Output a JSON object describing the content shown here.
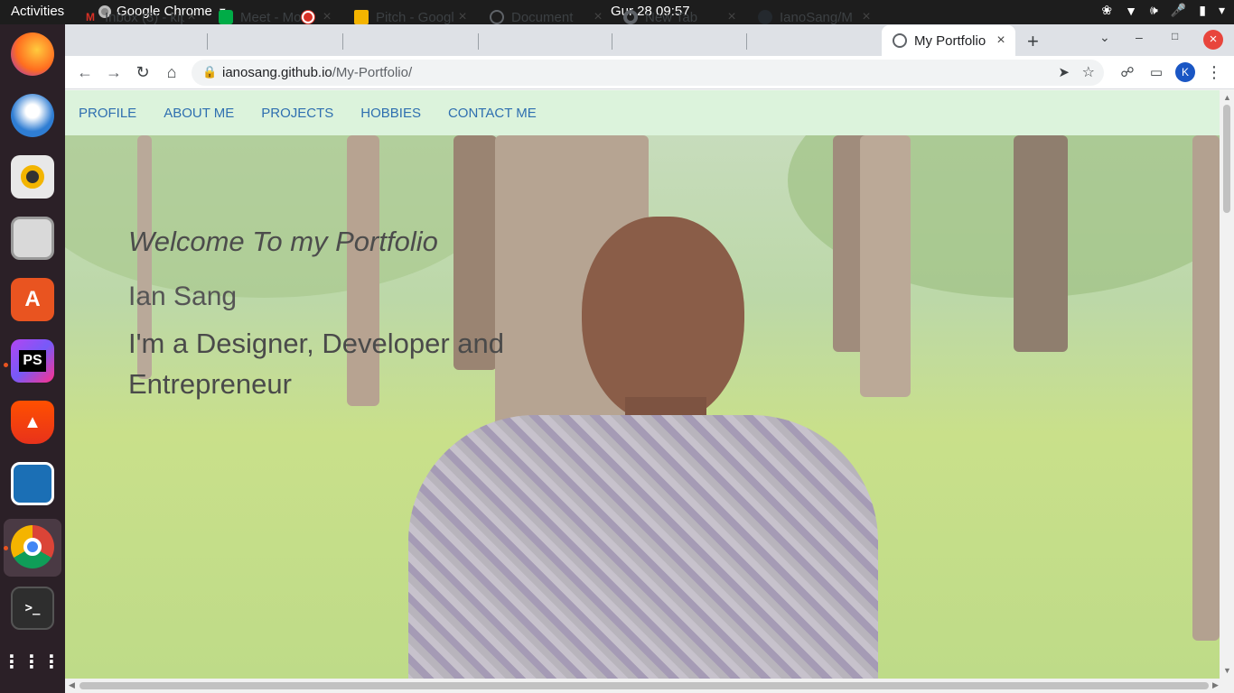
{
  "topbar": {
    "activities": "Activities",
    "app_name": "Google Chrome",
    "clock": "Gur 28  09:57"
  },
  "dock": {
    "items": [
      "firefox",
      "thunderbird",
      "rhythmbox",
      "files",
      "software",
      "phpstorm",
      "brave",
      "writer",
      "chrome",
      "terminal",
      "show-apps"
    ]
  },
  "browser": {
    "tabs": [
      {
        "label": "Inbox (3) - kip",
        "icon": "gmail-icon"
      },
      {
        "label": "Meet - Mo",
        "icon": "meet-icon"
      },
      {
        "label": "Pitch - Googl",
        "icon": "slides-icon"
      },
      {
        "label": "Document",
        "icon": "globe-icon"
      },
      {
        "label": "New Tab",
        "icon": "chrome-icon"
      },
      {
        "label": "IanoSang/M",
        "icon": "github-icon"
      },
      {
        "label": "My Portfolio",
        "icon": "globe-icon"
      }
    ],
    "url_host": "ianosang.github.io",
    "url_path": "/My-Portfolio/",
    "profile_initial": "K"
  },
  "page": {
    "nav": [
      "PROFILE",
      "ABOUT ME",
      "PROJECTS",
      "HOBBIES",
      "CONTACT ME"
    ],
    "welcome": "Welcome To my Portfolio",
    "name": "Ian Sang",
    "tagline": "I'm a Designer, Developer and Entrepreneur"
  },
  "colors": {
    "nav_bg": "#dcf3dc",
    "nav_link": "#2f6fb0",
    "topbar": "#1d1d1d",
    "dock": "#2b2027"
  }
}
